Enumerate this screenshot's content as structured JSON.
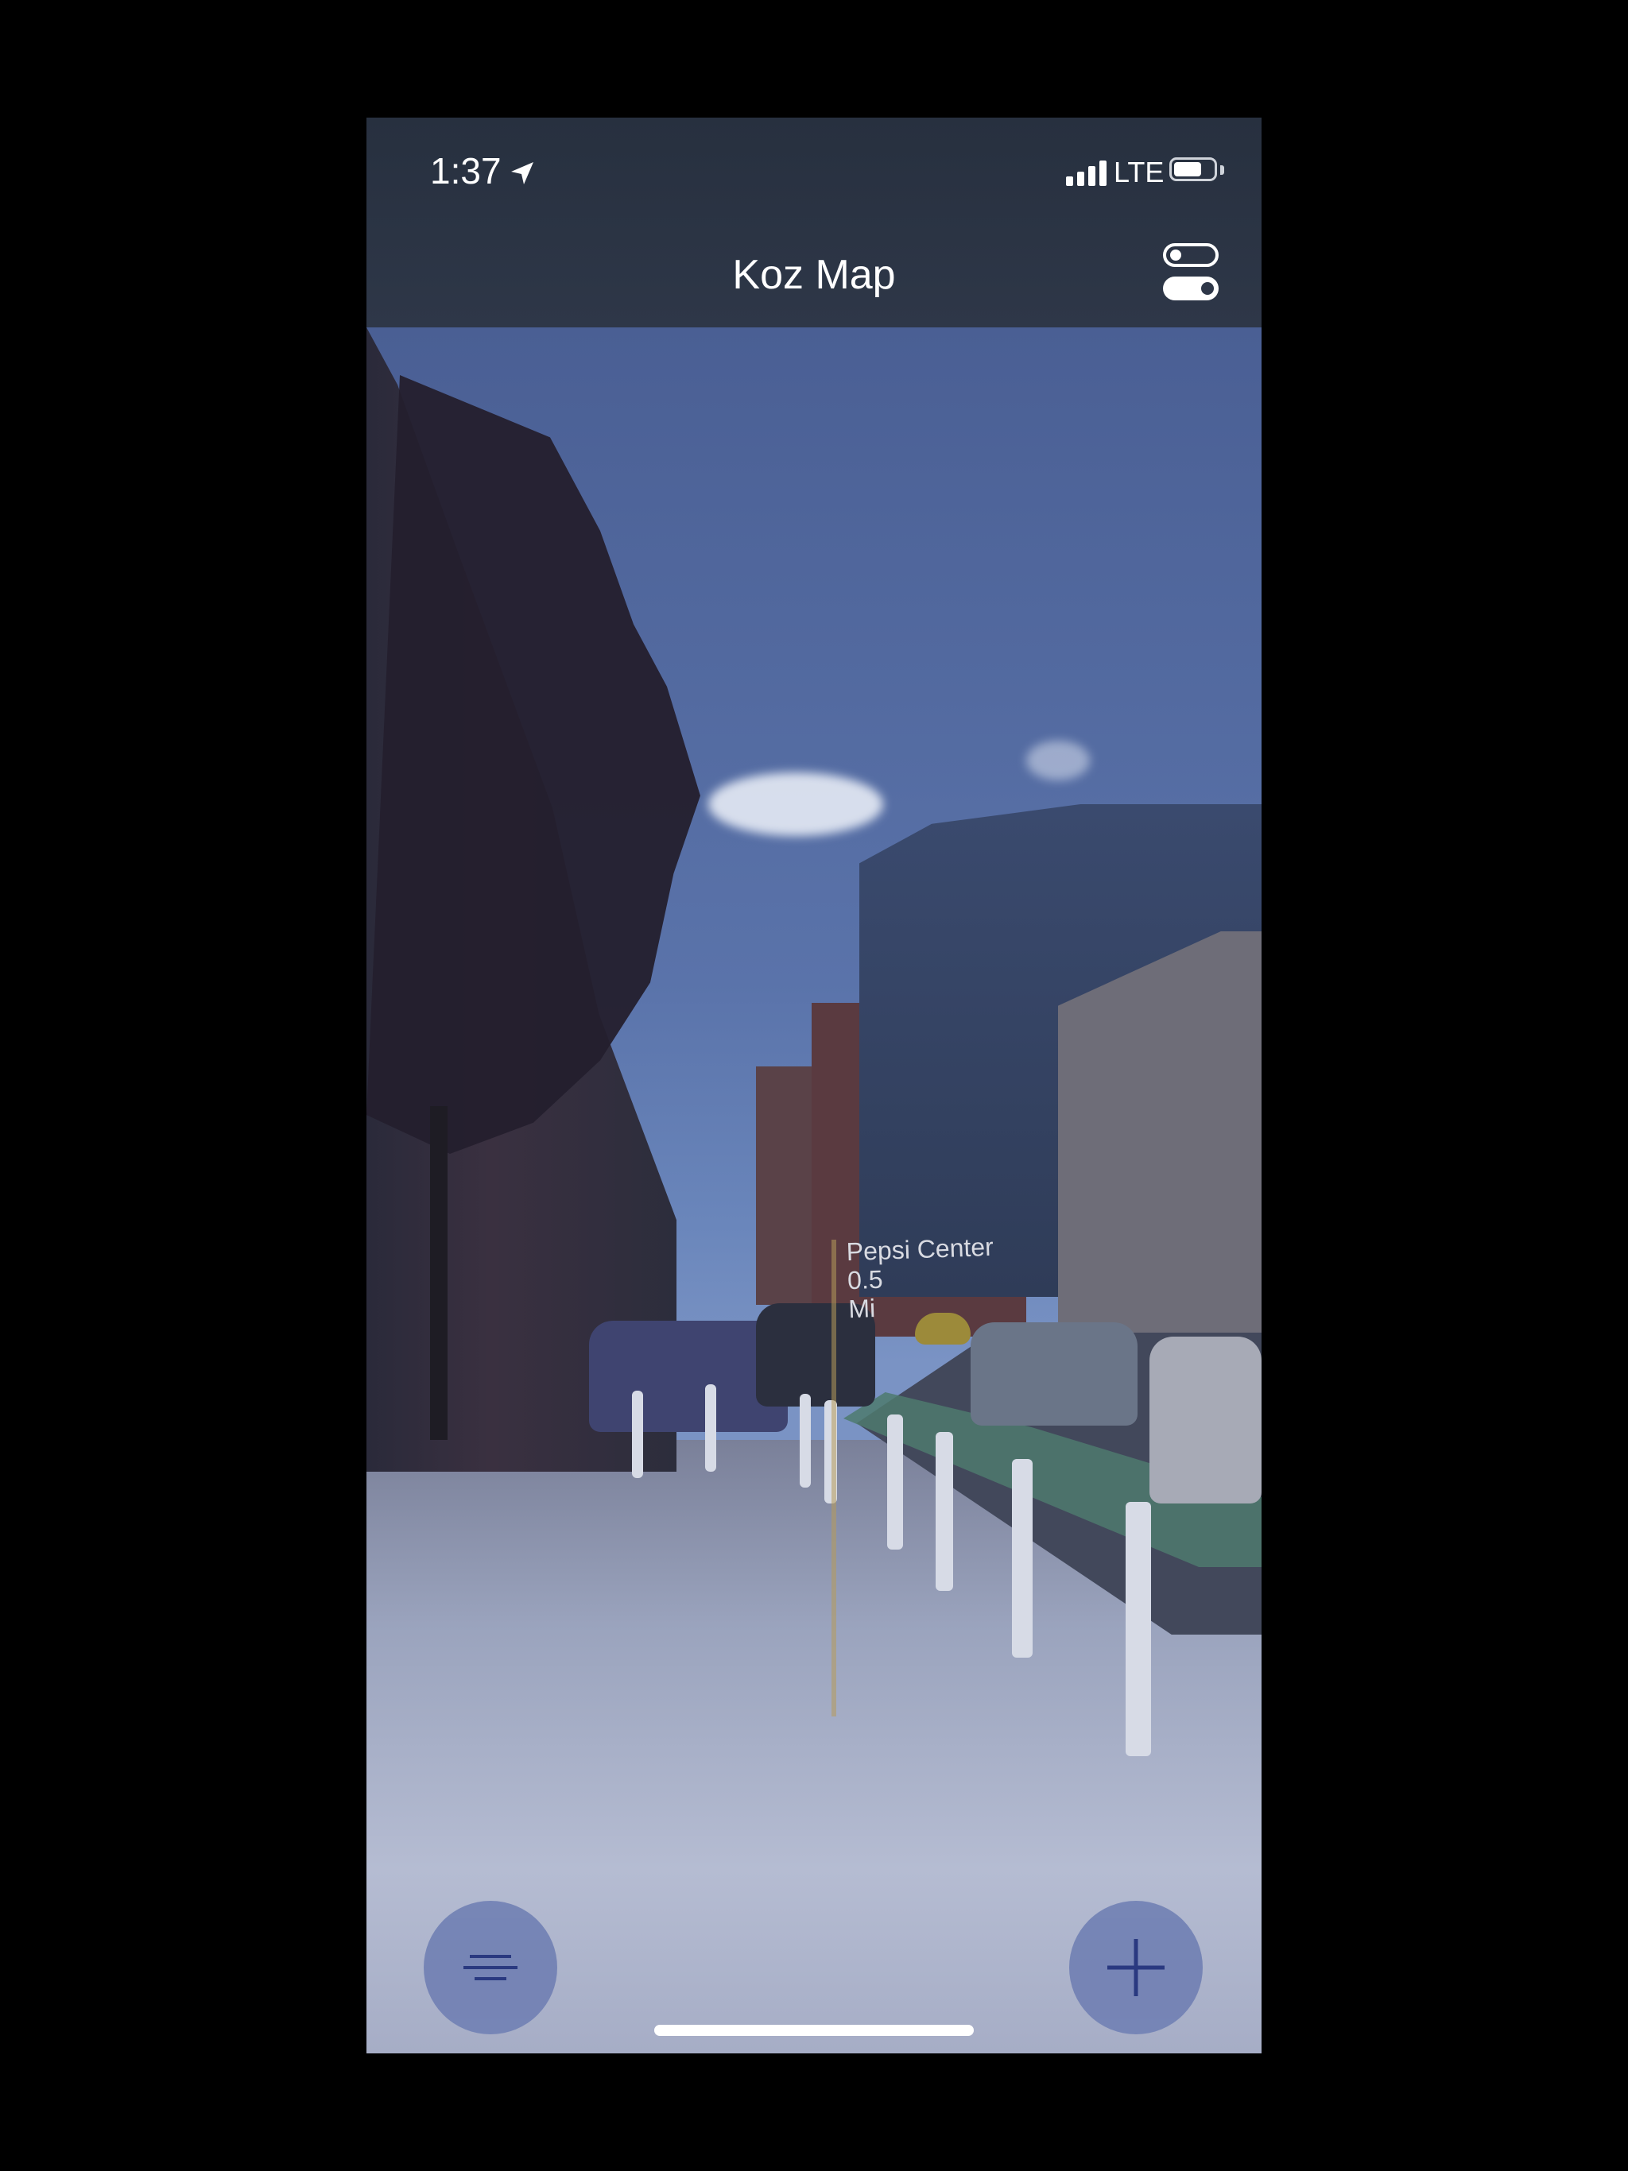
{
  "status_bar": {
    "time": "1:37",
    "network": "LTE",
    "battery_level": 0.7
  },
  "nav": {
    "title": "Koz Map"
  },
  "ar_markers": [
    {
      "name": "Pepsi Center",
      "distance": "0.5",
      "unit": "Mi"
    }
  ],
  "colors": {
    "nav_background": "#2e3748",
    "fab_background": "#7281b4",
    "fab_icon": "#1f2f7a",
    "ar_line": "#b79a5a"
  },
  "icons": {
    "filter_button": "filter-lines-icon",
    "add_button": "plus-icon",
    "settings_toggle": "toggles-icon",
    "location": "location-arrow-icon"
  }
}
